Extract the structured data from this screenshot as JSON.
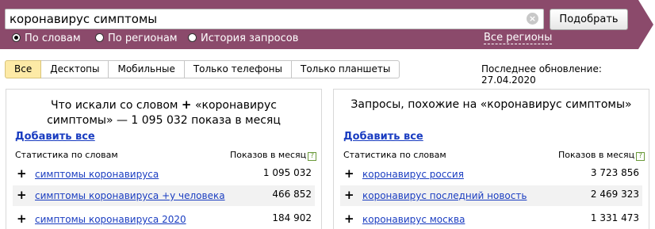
{
  "search": {
    "query": "коронавирус симптомы",
    "submit_label": "Подобрать",
    "clear_icon": "×"
  },
  "modes": [
    {
      "label": "По словам",
      "checked": true
    },
    {
      "label": "По регионам",
      "checked": false
    },
    {
      "label": "История запросов",
      "checked": false
    }
  ],
  "regions_link": "Все регионы",
  "device_tabs": [
    {
      "label": "Все",
      "active": true
    },
    {
      "label": "Десктопы",
      "active": false
    },
    {
      "label": "Мобильные",
      "active": false
    },
    {
      "label": "Только телефоны",
      "active": false
    },
    {
      "label": "Только планшеты",
      "active": false
    }
  ],
  "last_update": "Последнее обновление: 27.04.2020",
  "left_panel": {
    "title_line1_pre": "Что искали со словом",
    "title_line1_post": "«коронавирус",
    "title_line2": "симптомы» — 1 095 032 показа в месяц",
    "add_all": "Добавить все",
    "col_words": "Статистика по словам",
    "col_count": "Показов в месяц",
    "rows": [
      {
        "phrase": "симптомы коронавируса",
        "count": "1 095 032"
      },
      {
        "phrase": "симптомы коронавируса +у человека",
        "count": "466 852"
      },
      {
        "phrase": "симптомы коронавируса 2020",
        "count": "184 902"
      }
    ]
  },
  "right_panel": {
    "title": "Запросы, похожие на «коронавирус симптомы»",
    "add_all": "Добавить все",
    "col_words": "Статистика по словам",
    "col_count": "Показов в месяц",
    "rows": [
      {
        "phrase": "коронавирус россия",
        "count": "3 723 856"
      },
      {
        "phrase": "коронавирус последний новость",
        "count": "2 469 323"
      },
      {
        "phrase": "коронавирус москва",
        "count": "1 331 473"
      }
    ]
  },
  "colors": {
    "topbar": "#8b4a6b",
    "link": "#1a3dc1",
    "active_tab": "#fdeaa6",
    "row_shade": "#f2f2f2"
  },
  "icons": {
    "plus": "+",
    "help": "?"
  }
}
